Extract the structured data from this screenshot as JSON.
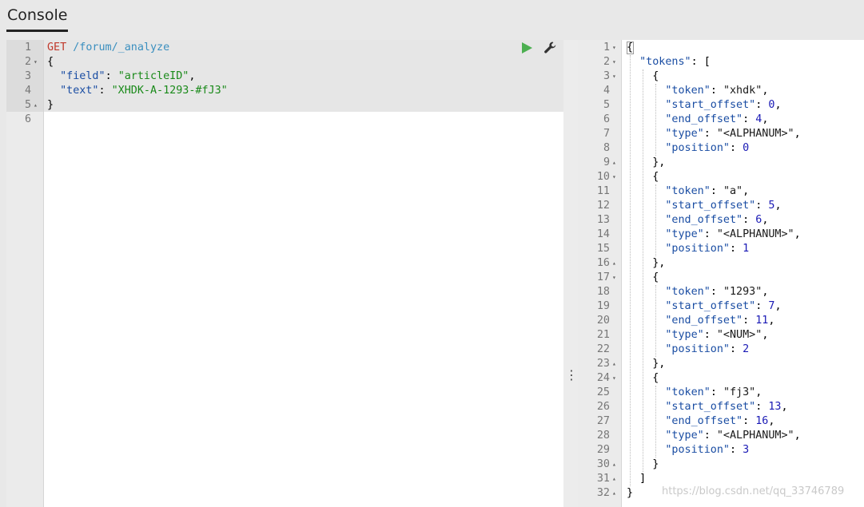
{
  "header": {
    "tab_label": "Console"
  },
  "request": {
    "lines": [
      {
        "n": "1",
        "fold": "",
        "parts": [
          {
            "t": "GET ",
            "c": "c-method"
          },
          {
            "t": "/forum/_analyze",
            "c": "c-url"
          }
        ]
      },
      {
        "n": "2",
        "fold": "▾",
        "parts": [
          {
            "t": "{",
            "c": "c-pun"
          }
        ]
      },
      {
        "n": "3",
        "fold": "",
        "parts": [
          {
            "t": "  ",
            "c": "c-pun"
          },
          {
            "t": "\"field\"",
            "c": "c-key"
          },
          {
            "t": ": ",
            "c": "c-pun"
          },
          {
            "t": "\"articleID\"",
            "c": "c-str"
          },
          {
            "t": ",",
            "c": "c-pun"
          }
        ]
      },
      {
        "n": "4",
        "fold": "",
        "parts": [
          {
            "t": "  ",
            "c": "c-pun"
          },
          {
            "t": "\"text\"",
            "c": "c-key"
          },
          {
            "t": ": ",
            "c": "c-pun"
          },
          {
            "t": "\"XHDK-A-1293-#fJ3\"",
            "c": "c-str"
          }
        ]
      },
      {
        "n": "5",
        "fold": "▴",
        "parts": [
          {
            "t": "}",
            "c": "c-pun"
          }
        ]
      },
      {
        "n": "6",
        "fold": "",
        "parts": []
      }
    ],
    "run_icon": "play-icon",
    "settings_icon": "wrench-icon"
  },
  "response": {
    "lines": [
      {
        "n": "1",
        "fold": "▾",
        "parts": [
          {
            "t": "{",
            "c": "c-pun"
          }
        ]
      },
      {
        "n": "2",
        "fold": "▾",
        "parts": [
          {
            "t": "  ",
            "c": "c-pun"
          },
          {
            "t": "\"tokens\"",
            "c": "c-key"
          },
          {
            "t": ": [",
            "c": "c-pun"
          }
        ]
      },
      {
        "n": "3",
        "fold": "▾",
        "parts": [
          {
            "t": "    {",
            "c": "c-pun"
          }
        ]
      },
      {
        "n": "4",
        "fold": "",
        "parts": [
          {
            "t": "      ",
            "c": "c-pun"
          },
          {
            "t": "\"token\"",
            "c": "c-key"
          },
          {
            "t": ": ",
            "c": "c-pun"
          },
          {
            "t": "\"xhdk\"",
            "c": "c-str-r"
          },
          {
            "t": ",",
            "c": "c-pun"
          }
        ]
      },
      {
        "n": "5",
        "fold": "",
        "parts": [
          {
            "t": "      ",
            "c": "c-pun"
          },
          {
            "t": "\"start_offset\"",
            "c": "c-key"
          },
          {
            "t": ": ",
            "c": "c-pun"
          },
          {
            "t": "0",
            "c": "c-num"
          },
          {
            "t": ",",
            "c": "c-pun"
          }
        ]
      },
      {
        "n": "6",
        "fold": "",
        "parts": [
          {
            "t": "      ",
            "c": "c-pun"
          },
          {
            "t": "\"end_offset\"",
            "c": "c-key"
          },
          {
            "t": ": ",
            "c": "c-pun"
          },
          {
            "t": "4",
            "c": "c-num"
          },
          {
            "t": ",",
            "c": "c-pun"
          }
        ]
      },
      {
        "n": "7",
        "fold": "",
        "parts": [
          {
            "t": "      ",
            "c": "c-pun"
          },
          {
            "t": "\"type\"",
            "c": "c-key"
          },
          {
            "t": ": ",
            "c": "c-pun"
          },
          {
            "t": "\"<ALPHANUM>\"",
            "c": "c-str-r"
          },
          {
            "t": ",",
            "c": "c-pun"
          }
        ]
      },
      {
        "n": "8",
        "fold": "",
        "parts": [
          {
            "t": "      ",
            "c": "c-pun"
          },
          {
            "t": "\"position\"",
            "c": "c-key"
          },
          {
            "t": ": ",
            "c": "c-pun"
          },
          {
            "t": "0",
            "c": "c-num"
          }
        ]
      },
      {
        "n": "9",
        "fold": "▴",
        "parts": [
          {
            "t": "    },",
            "c": "c-pun"
          }
        ]
      },
      {
        "n": "10",
        "fold": "▾",
        "parts": [
          {
            "t": "    {",
            "c": "c-pun"
          }
        ]
      },
      {
        "n": "11",
        "fold": "",
        "parts": [
          {
            "t": "      ",
            "c": "c-pun"
          },
          {
            "t": "\"token\"",
            "c": "c-key"
          },
          {
            "t": ": ",
            "c": "c-pun"
          },
          {
            "t": "\"a\"",
            "c": "c-str-r"
          },
          {
            "t": ",",
            "c": "c-pun"
          }
        ]
      },
      {
        "n": "12",
        "fold": "",
        "parts": [
          {
            "t": "      ",
            "c": "c-pun"
          },
          {
            "t": "\"start_offset\"",
            "c": "c-key"
          },
          {
            "t": ": ",
            "c": "c-pun"
          },
          {
            "t": "5",
            "c": "c-num"
          },
          {
            "t": ",",
            "c": "c-pun"
          }
        ]
      },
      {
        "n": "13",
        "fold": "",
        "parts": [
          {
            "t": "      ",
            "c": "c-pun"
          },
          {
            "t": "\"end_offset\"",
            "c": "c-key"
          },
          {
            "t": ": ",
            "c": "c-pun"
          },
          {
            "t": "6",
            "c": "c-num"
          },
          {
            "t": ",",
            "c": "c-pun"
          }
        ]
      },
      {
        "n": "14",
        "fold": "",
        "parts": [
          {
            "t": "      ",
            "c": "c-pun"
          },
          {
            "t": "\"type\"",
            "c": "c-key"
          },
          {
            "t": ": ",
            "c": "c-pun"
          },
          {
            "t": "\"<ALPHANUM>\"",
            "c": "c-str-r"
          },
          {
            "t": ",",
            "c": "c-pun"
          }
        ]
      },
      {
        "n": "15",
        "fold": "",
        "parts": [
          {
            "t": "      ",
            "c": "c-pun"
          },
          {
            "t": "\"position\"",
            "c": "c-key"
          },
          {
            "t": ": ",
            "c": "c-pun"
          },
          {
            "t": "1",
            "c": "c-num"
          }
        ]
      },
      {
        "n": "16",
        "fold": "▴",
        "parts": [
          {
            "t": "    },",
            "c": "c-pun"
          }
        ]
      },
      {
        "n": "17",
        "fold": "▾",
        "parts": [
          {
            "t": "    {",
            "c": "c-pun"
          }
        ]
      },
      {
        "n": "18",
        "fold": "",
        "parts": [
          {
            "t": "      ",
            "c": "c-pun"
          },
          {
            "t": "\"token\"",
            "c": "c-key"
          },
          {
            "t": ": ",
            "c": "c-pun"
          },
          {
            "t": "\"1293\"",
            "c": "c-str-r"
          },
          {
            "t": ",",
            "c": "c-pun"
          }
        ]
      },
      {
        "n": "19",
        "fold": "",
        "parts": [
          {
            "t": "      ",
            "c": "c-pun"
          },
          {
            "t": "\"start_offset\"",
            "c": "c-key"
          },
          {
            "t": ": ",
            "c": "c-pun"
          },
          {
            "t": "7",
            "c": "c-num"
          },
          {
            "t": ",",
            "c": "c-pun"
          }
        ]
      },
      {
        "n": "20",
        "fold": "",
        "parts": [
          {
            "t": "      ",
            "c": "c-pun"
          },
          {
            "t": "\"end_offset\"",
            "c": "c-key"
          },
          {
            "t": ": ",
            "c": "c-pun"
          },
          {
            "t": "11",
            "c": "c-num"
          },
          {
            "t": ",",
            "c": "c-pun"
          }
        ]
      },
      {
        "n": "21",
        "fold": "",
        "parts": [
          {
            "t": "      ",
            "c": "c-pun"
          },
          {
            "t": "\"type\"",
            "c": "c-key"
          },
          {
            "t": ": ",
            "c": "c-pun"
          },
          {
            "t": "\"<NUM>\"",
            "c": "c-str-r"
          },
          {
            "t": ",",
            "c": "c-pun"
          }
        ]
      },
      {
        "n": "22",
        "fold": "",
        "parts": [
          {
            "t": "      ",
            "c": "c-pun"
          },
          {
            "t": "\"position\"",
            "c": "c-key"
          },
          {
            "t": ": ",
            "c": "c-pun"
          },
          {
            "t": "2",
            "c": "c-num"
          }
        ]
      },
      {
        "n": "23",
        "fold": "▴",
        "parts": [
          {
            "t": "    },",
            "c": "c-pun"
          }
        ]
      },
      {
        "n": "24",
        "fold": "▾",
        "parts": [
          {
            "t": "    {",
            "c": "c-pun"
          }
        ]
      },
      {
        "n": "25",
        "fold": "",
        "parts": [
          {
            "t": "      ",
            "c": "c-pun"
          },
          {
            "t": "\"token\"",
            "c": "c-key"
          },
          {
            "t": ": ",
            "c": "c-pun"
          },
          {
            "t": "\"fj3\"",
            "c": "c-str-r"
          },
          {
            "t": ",",
            "c": "c-pun"
          }
        ]
      },
      {
        "n": "26",
        "fold": "",
        "parts": [
          {
            "t": "      ",
            "c": "c-pun"
          },
          {
            "t": "\"start_offset\"",
            "c": "c-key"
          },
          {
            "t": ": ",
            "c": "c-pun"
          },
          {
            "t": "13",
            "c": "c-num"
          },
          {
            "t": ",",
            "c": "c-pun"
          }
        ]
      },
      {
        "n": "27",
        "fold": "",
        "parts": [
          {
            "t": "      ",
            "c": "c-pun"
          },
          {
            "t": "\"end_offset\"",
            "c": "c-key"
          },
          {
            "t": ": ",
            "c": "c-pun"
          },
          {
            "t": "16",
            "c": "c-num"
          },
          {
            "t": ",",
            "c": "c-pun"
          }
        ]
      },
      {
        "n": "28",
        "fold": "",
        "parts": [
          {
            "t": "      ",
            "c": "c-pun"
          },
          {
            "t": "\"type\"",
            "c": "c-key"
          },
          {
            "t": ": ",
            "c": "c-pun"
          },
          {
            "t": "\"<ALPHANUM>\"",
            "c": "c-str-r"
          },
          {
            "t": ",",
            "c": "c-pun"
          }
        ]
      },
      {
        "n": "29",
        "fold": "",
        "parts": [
          {
            "t": "      ",
            "c": "c-pun"
          },
          {
            "t": "\"position\"",
            "c": "c-key"
          },
          {
            "t": ": ",
            "c": "c-pun"
          },
          {
            "t": "3",
            "c": "c-num"
          }
        ]
      },
      {
        "n": "30",
        "fold": "▴",
        "parts": [
          {
            "t": "    }",
            "c": "c-pun"
          }
        ]
      },
      {
        "n": "31",
        "fold": "▴",
        "parts": [
          {
            "t": "  ]",
            "c": "c-pun"
          }
        ]
      },
      {
        "n": "32",
        "fold": "▴",
        "parts": [
          {
            "t": "}",
            "c": "c-pun"
          }
        ]
      }
    ]
  },
  "divider": {
    "icon": "drag-handle-icon",
    "glyph": "⋮"
  },
  "watermark": "https://blog.csdn.net/qq_33746789",
  "colors": {
    "method": "#c0392b",
    "url": "#3a8fbf",
    "key": "#1a4da3",
    "string": "#1a8a1a",
    "number": "#1a1ab5",
    "run": "#4caf50"
  }
}
